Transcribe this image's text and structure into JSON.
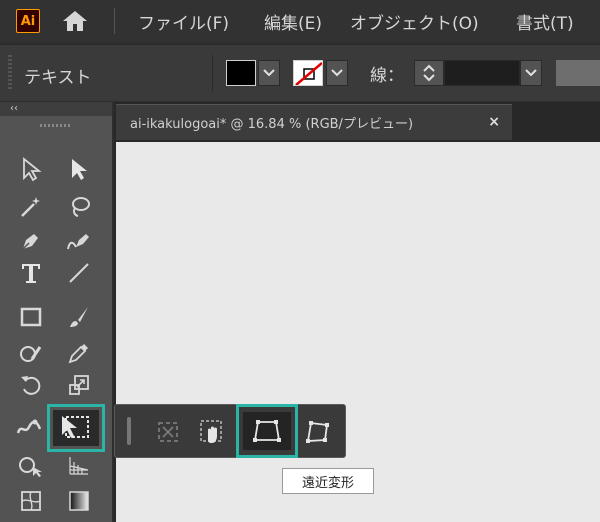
{
  "app": {
    "logo_text": "Ai"
  },
  "menu": {
    "items": [
      {
        "label": "ファイル(F)"
      },
      {
        "label": "編集(E)"
      },
      {
        "label": "オブジェクト(O)"
      },
      {
        "label": "書式(T)"
      }
    ]
  },
  "control_bar": {
    "label": "テキスト",
    "stroke_label": "線：",
    "stroke_value": ""
  },
  "toolbar": {
    "collapse_glyph": "‹‹"
  },
  "document": {
    "tab_title": "ai-ikakulogoai* @ 16.84 % (RGB/プレビュー)",
    "close_glyph": "×"
  },
  "flyout": {
    "selected_tool": "perspective-distort",
    "tooltip": "遠近変形"
  },
  "colors": {
    "highlight": "#2bb5a6",
    "logo_orange": "#ff9a00",
    "canvas": "#e9e9e9"
  }
}
